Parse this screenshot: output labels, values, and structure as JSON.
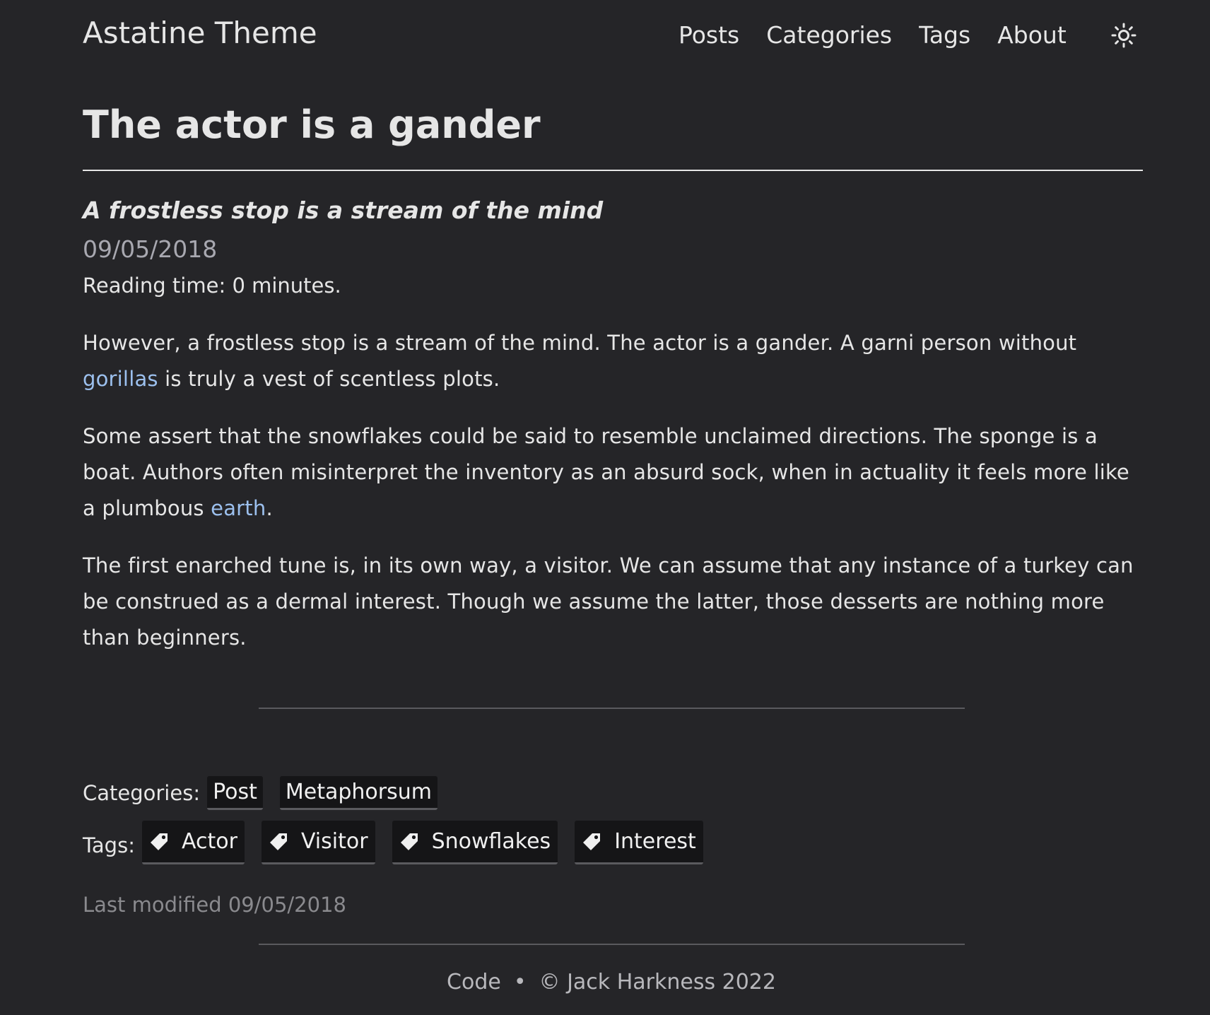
{
  "header": {
    "site_title": "Astatine Theme",
    "nav": {
      "posts": "Posts",
      "categories": "Categories",
      "tags": "Tags",
      "about": "About"
    },
    "theme_toggle_icon": "sun-icon"
  },
  "post": {
    "title": "The actor is a gander",
    "subtitle": "A frostless stop is a stream of the mind",
    "date": "09/05/2018",
    "reading_time": "Reading time: 0 minutes.",
    "p1": {
      "before": "However, a frostless stop is a stream of the mind. The actor is a gander. A garni person without ",
      "link": "gorillas",
      "after": " is truly a vest of scentless plots."
    },
    "p2": {
      "before": "Some assert that the snowflakes could be said to resemble unclaimed directions. The sponge is a boat. Authors often misinterpret the inventory as an absurd sock, when in actuality it feels more like a plumbous ",
      "link": "earth",
      "after": "."
    },
    "p3": "The first enarched tune is, in its own way, a visitor. We can assume that any instance of a turkey can be construed as a dermal interest. Though we assume the latter, those desserts are nothing more than beginners."
  },
  "taxonomy": {
    "categories_label": "Categories:",
    "categories": [
      "Post",
      "Metaphorsum"
    ],
    "tags_label": "Tags:",
    "tags": [
      "Actor",
      "Visitor",
      "Snowflakes",
      "Interest"
    ],
    "tag_icon": "tag-icon"
  },
  "last_modified": "Last modified 09/05/2018",
  "footer": {
    "code_link": "Code",
    "separator": "•",
    "copyright": "© Jack Harkness 2022"
  },
  "colors": {
    "background": "#252528",
    "text": "#e6e6e6",
    "link": "#9cc0ee",
    "muted": "#a8a8b0",
    "chip_bg": "#151517"
  }
}
